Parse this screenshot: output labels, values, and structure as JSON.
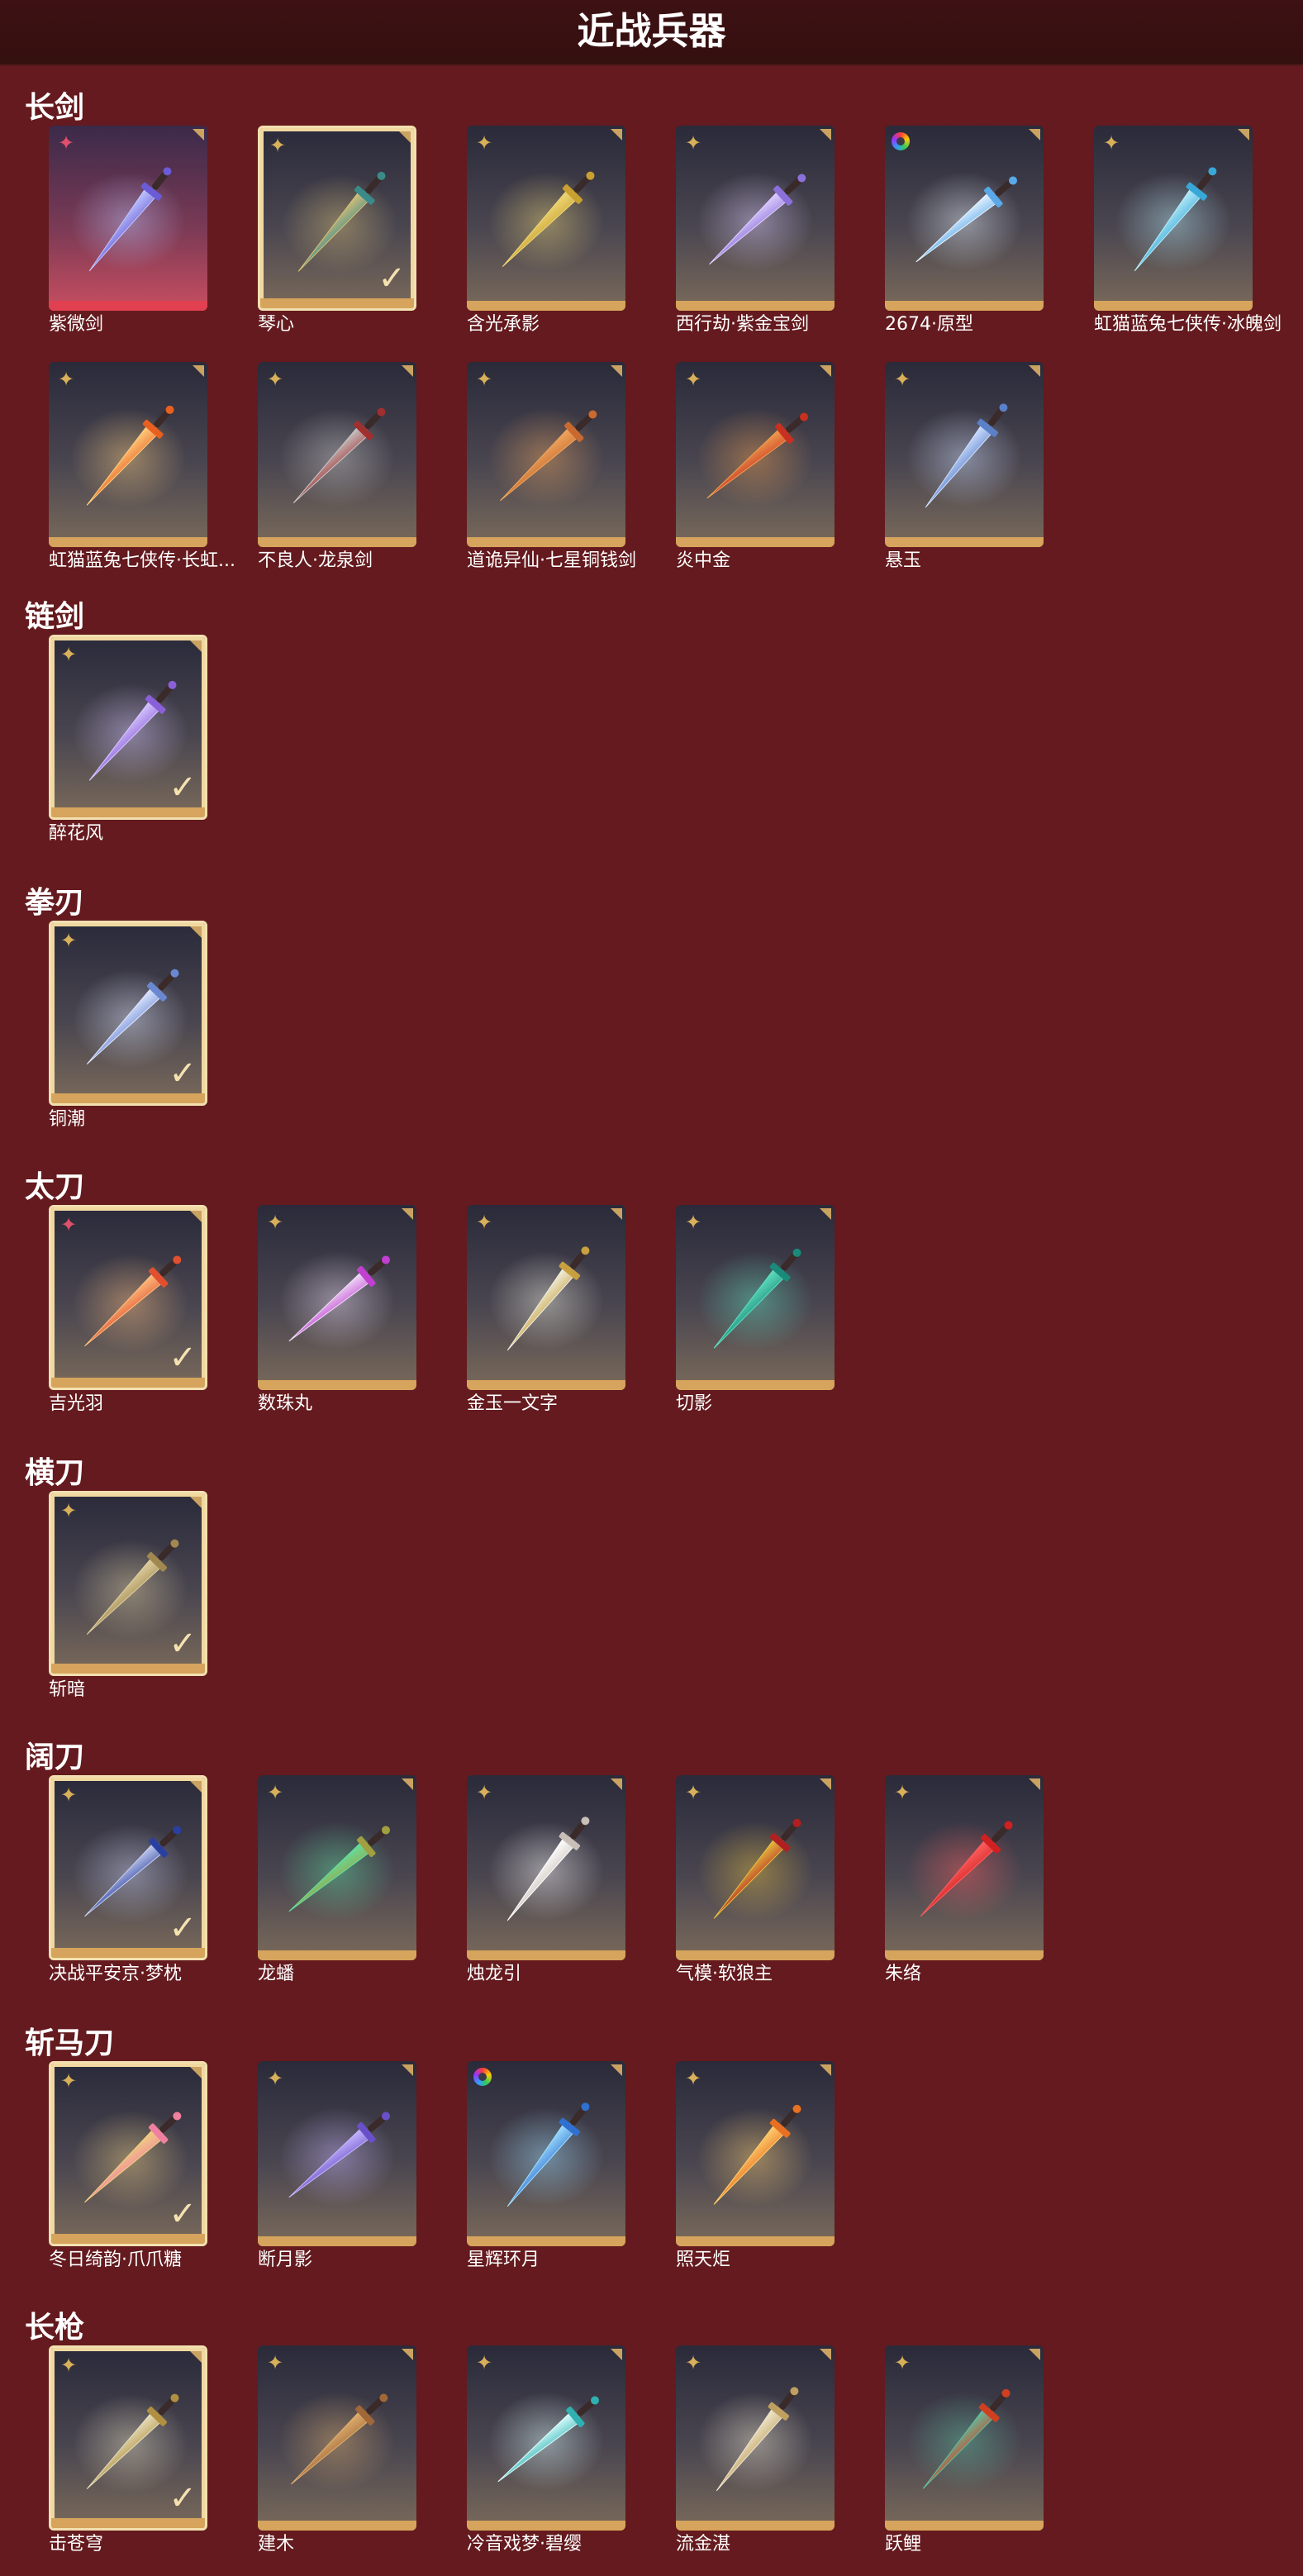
{
  "page_title": "近战兵器",
  "colors": {
    "background": "#641a1e",
    "card_bottom": "#d6a45c",
    "badge_gold": "#d8b05a",
    "badge_pink": "#e0506a"
  },
  "sections": [
    {
      "title": "长剑",
      "items": [
        {
          "label": "紫微剑",
          "badge": "pink-star",
          "selected": false,
          "red": true,
          "colors": [
            "#6b5bd6",
            "#c0c8ff"
          ]
        },
        {
          "label": "琴心",
          "badge": "gold-star",
          "selected": true,
          "colors": [
            "#3a8a8a",
            "#d8c078"
          ]
        },
        {
          "label": "含光承影",
          "badge": "gold-star",
          "selected": false,
          "colors": [
            "#c8a030",
            "#f0d878"
          ]
        },
        {
          "label": "西行劫·紫金宝剑",
          "badge": "gold-star",
          "selected": false,
          "colors": [
            "#8a70d8",
            "#e0d0ff"
          ]
        },
        {
          "label": "2674·原型",
          "badge": "rainbow",
          "selected": false,
          "colors": [
            "#5aa8e8",
            "#e8f4ff"
          ]
        },
        {
          "label": "虹猫蓝兔七侠传·冰魄剑",
          "badge": "gold-star",
          "selected": false,
          "colors": [
            "#38a8d8",
            "#b8ecf8"
          ]
        },
        {
          "label": "虹猫蓝兔七侠传·长虹剑",
          "display": "虹猫蓝兔七侠传·长虹...",
          "badge": "gold-star",
          "selected": false,
          "colors": [
            "#e86020",
            "#ffd080"
          ]
        },
        {
          "label": "不良人·龙泉剑",
          "badge": "gold-star",
          "selected": false,
          "colors": [
            "#a03030",
            "#c8c8c8"
          ]
        },
        {
          "label": "道诡异仙·七星铜钱剑",
          "badge": "gold-star",
          "selected": false,
          "colors": [
            "#c86a30",
            "#f0a860"
          ]
        },
        {
          "label": "炎中金",
          "badge": "gold-star",
          "selected": false,
          "colors": [
            "#c83020",
            "#f0a050"
          ]
        },
        {
          "label": "悬玉",
          "badge": "gold-star",
          "selected": false,
          "colors": [
            "#5a80c8",
            "#d0e0ff"
          ]
        }
      ]
    },
    {
      "title": "链剑",
      "items": [
        {
          "label": "醉花风",
          "badge": "gold-star",
          "selected": true,
          "colors": [
            "#8a60d8",
            "#d8c8ff"
          ]
        }
      ]
    },
    {
      "title": "拳刃",
      "items": [
        {
          "label": "铜潮",
          "badge": "gold-star",
          "selected": true,
          "colors": [
            "#6a88d0",
            "#e0e8ff"
          ]
        }
      ]
    },
    {
      "title": "太刀",
      "items": [
        {
          "label": "吉光羽",
          "badge": "pink-star",
          "selected": true,
          "colors": [
            "#e05030",
            "#ffc080"
          ]
        },
        {
          "label": "数珠丸",
          "badge": "gold-star",
          "selected": false,
          "colors": [
            "#c040d0",
            "#f0e0f8"
          ]
        },
        {
          "label": "金玉一文字",
          "badge": "gold-star",
          "selected": false,
          "colors": [
            "#c8a040",
            "#f0f0e0"
          ]
        },
        {
          "label": "切影",
          "badge": "gold-star",
          "selected": false,
          "colors": [
            "#1a8a7a",
            "#60e0c0"
          ]
        }
      ]
    },
    {
      "title": "横刀",
      "items": [
        {
          "label": "斩暗",
          "badge": "gold-star",
          "selected": true,
          "colors": [
            "#a08850",
            "#e0d0a0"
          ]
        }
      ]
    },
    {
      "title": "阔刀",
      "items": [
        {
          "label": "决战平安京·梦枕",
          "badge": "gold-star",
          "selected": true,
          "colors": [
            "#2a40a0",
            "#c8d0f0"
          ]
        },
        {
          "label": "龙蟠",
          "badge": "gold-star",
          "selected": false,
          "colors": [
            "#a0a040",
            "#60e0a0"
          ]
        },
        {
          "label": "烛龙引",
          "badge": "gold-star",
          "selected": false,
          "colors": [
            "#c8c0b8",
            "#ffffff"
          ]
        },
        {
          "label": "气模·软狼主",
          "badge": "gold-star",
          "selected": false,
          "colors": [
            "#b02020",
            "#e8c040"
          ]
        },
        {
          "label": "朱络",
          "badge": "gold-star",
          "selected": false,
          "colors": [
            "#d02020",
            "#ff6060"
          ]
        }
      ]
    },
    {
      "title": "斩马刀",
      "items": [
        {
          "label": "冬日绮韵·爪爪糖",
          "badge": "gold-star",
          "selected": true,
          "colors": [
            "#f080a0",
            "#f0d080"
          ]
        },
        {
          "label": "断月影",
          "badge": "gold-star",
          "selected": false,
          "colors": [
            "#6a50c8",
            "#c8b8ff"
          ]
        },
        {
          "label": "星辉环月",
          "badge": "rainbow",
          "selected": false,
          "colors": [
            "#3070d0",
            "#a0e0ff"
          ]
        },
        {
          "label": "照天炬",
          "badge": "gold-star",
          "selected": false,
          "colors": [
            "#e87020",
            "#ffd070"
          ]
        }
      ]
    },
    {
      "title": "长枪",
      "items": [
        {
          "label": "击苍穹",
          "badge": "gold-star",
          "selected": true,
          "colors": [
            "#b09040",
            "#e8e0c0"
          ]
        },
        {
          "label": "建木",
          "badge": "gold-star",
          "selected": false,
          "colors": [
            "#a06838",
            "#e0b070"
          ]
        },
        {
          "label": "冷音戏梦·碧缨",
          "badge": "gold-star",
          "selected": false,
          "colors": [
            "#30b0b0",
            "#e0ffff"
          ]
        },
        {
          "label": "流金湛",
          "badge": "gold-star",
          "selected": false,
          "colors": [
            "#c0a060",
            "#f0e8d0"
          ]
        },
        {
          "label": "跃鲤",
          "badge": "gold-star",
          "selected": false,
          "colors": [
            "#d04020",
            "#60c0a0"
          ]
        }
      ]
    }
  ]
}
